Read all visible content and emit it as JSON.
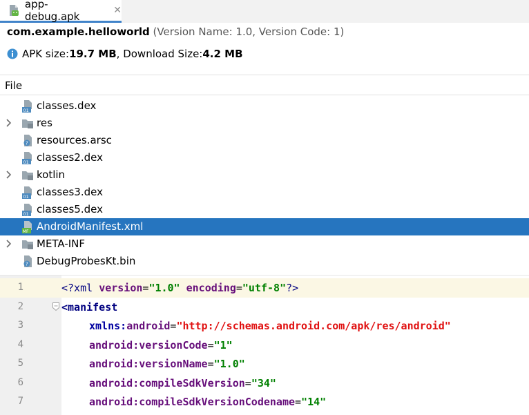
{
  "tab": {
    "label": "app-debug.apk",
    "close": "✕"
  },
  "header": {
    "package": "com.example.helloworld",
    "version_info": "(Version Name: 1.0, Version Code: 1)",
    "apk_size_label": "APK size: ",
    "apk_size": "19.7 MB",
    "download_size_label": ", Download Size: ",
    "download_size": "4.2 MB"
  },
  "tree": {
    "column_header": "File",
    "items": [
      {
        "label": "classes.dex",
        "icon": "dex-file-icon",
        "expandable": false
      },
      {
        "label": "res",
        "icon": "folder-icon",
        "expandable": true
      },
      {
        "label": "resources.arsc",
        "icon": "unknown-file-icon",
        "expandable": false
      },
      {
        "label": "classes2.dex",
        "icon": "dex-file-icon",
        "expandable": false
      },
      {
        "label": "kotlin",
        "icon": "folder-icon",
        "expandable": true
      },
      {
        "label": "classes3.dex",
        "icon": "dex-file-icon",
        "expandable": false
      },
      {
        "label": "classes5.dex",
        "icon": "dex-file-icon",
        "expandable": false
      },
      {
        "label": "AndroidManifest.xml",
        "icon": "manifest-file-icon",
        "expandable": false,
        "selected": true
      },
      {
        "label": "META-INF",
        "icon": "folder-icon",
        "expandable": true
      },
      {
        "label": "DebugProbesKt.bin",
        "icon": "unknown-file-icon",
        "expandable": false
      }
    ]
  },
  "editor": {
    "line_numbers": [
      "1",
      "2",
      "3",
      "4",
      "5",
      "6",
      "7"
    ],
    "lines": {
      "l1_open": "<?xml ",
      "l1_a1": "version",
      "l1_eq1": "=",
      "l1_v1": "\"1.0\"",
      "l1_sp": " ",
      "l1_a2": "encoding",
      "l1_eq2": "=",
      "l1_v2": "\"utf-8\"",
      "l1_close": "?>",
      "l2_tag": "<manifest",
      "l3_ns": "xmlns:",
      "l3_attr": "android",
      "l3_eq": "=",
      "l3_val": "\"http://schemas.android.com/apk/res/android\"",
      "l4_attr": "android:versionCode",
      "l4_eq": "=",
      "l4_val": "\"1\"",
      "l5_attr": "android:versionName",
      "l5_eq": "=",
      "l5_val": "\"1.0\"",
      "l6_attr": "android:compileSdkVersion",
      "l6_eq": "=",
      "l6_val": "\"34\"",
      "l7_attr": "android:compileSdkVersionCodename",
      "l7_eq": "=",
      "l7_val": "\"14\""
    }
  },
  "colors": {
    "selection": "#2675bf",
    "tab_underline": "#4083c9",
    "info_icon": "#3d8fd1"
  }
}
